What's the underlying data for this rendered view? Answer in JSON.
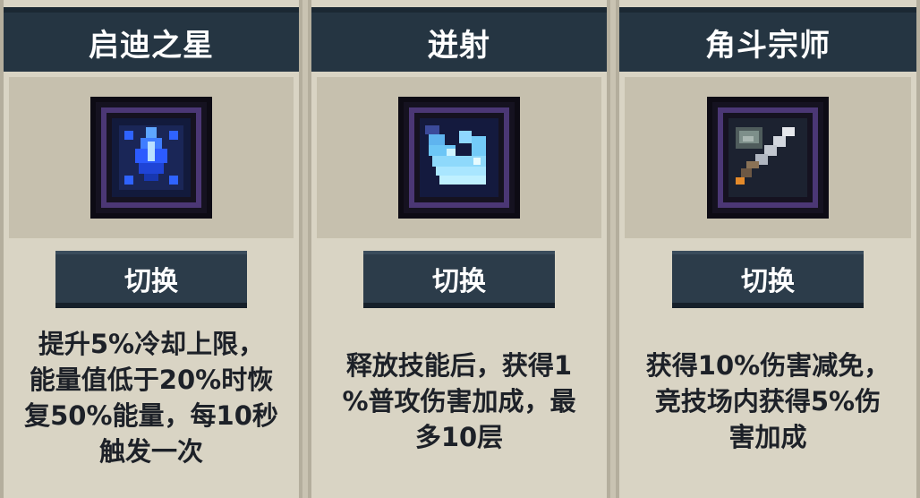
{
  "cards": [
    {
      "title": "启迪之星",
      "icon": "blue-star-crystal-icon",
      "button_label": "切换",
      "description_lines": [
        "提升5%冷却上限，",
        "能量值低于20%时恢",
        "复50%能量，每10秒",
        "触发一次"
      ]
    },
    {
      "title": "迸射",
      "icon": "ice-burst-icon",
      "button_label": "切换",
      "description_lines": [
        "释放技能后，获得1",
        "%普攻伤害加成，最",
        "多10层"
      ]
    },
    {
      "title": "角斗宗师",
      "icon": "gladiator-sword-icon",
      "button_label": "切换",
      "description_lines": [
        "获得10%伤害减免，",
        "竞技场内获得5%伤",
        "害加成"
      ]
    }
  ],
  "colors": {
    "background": "#c9c3b2",
    "card": "#d9d4c4",
    "header": "#253542",
    "button": "#2c3c4a",
    "frame_border": "#4b3775"
  }
}
